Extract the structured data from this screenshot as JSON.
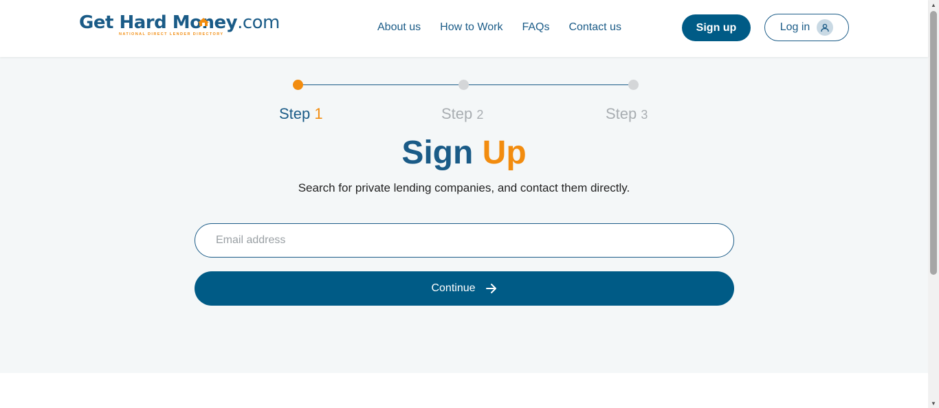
{
  "header": {
    "logo_text": "Get Hard Money",
    "logo_suffix": ".com",
    "logo_tagline": "NATIONAL DIRECT LENDER DIRECTORY",
    "nav": [
      "About us",
      "How to Work",
      "FAQs",
      "Contact us"
    ],
    "signup_label": "Sign up",
    "login_label": "Log in"
  },
  "stepper": {
    "steps": [
      {
        "word": "Step",
        "num": "1",
        "active": true
      },
      {
        "word": "Step",
        "num": "2",
        "active": false
      },
      {
        "word": "Step",
        "num": "3",
        "active": false
      }
    ]
  },
  "signup": {
    "title_part1": "Sign",
    "title_part2": "Up",
    "subtitle": "Search for private lending companies, and contact them directly.",
    "email_placeholder": "Email address",
    "email_value": "",
    "continue_label": "Continue"
  },
  "colors": {
    "brand_blue": "#1a5b87",
    "button_blue": "#005b86",
    "accent_orange": "#f28c0f",
    "inactive_gray": "#a8adb1",
    "page_bg": "#f4f7f8"
  },
  "icons": {
    "login": "user-icon",
    "continue": "arrow-right-icon",
    "logo_o": "house-icon"
  }
}
